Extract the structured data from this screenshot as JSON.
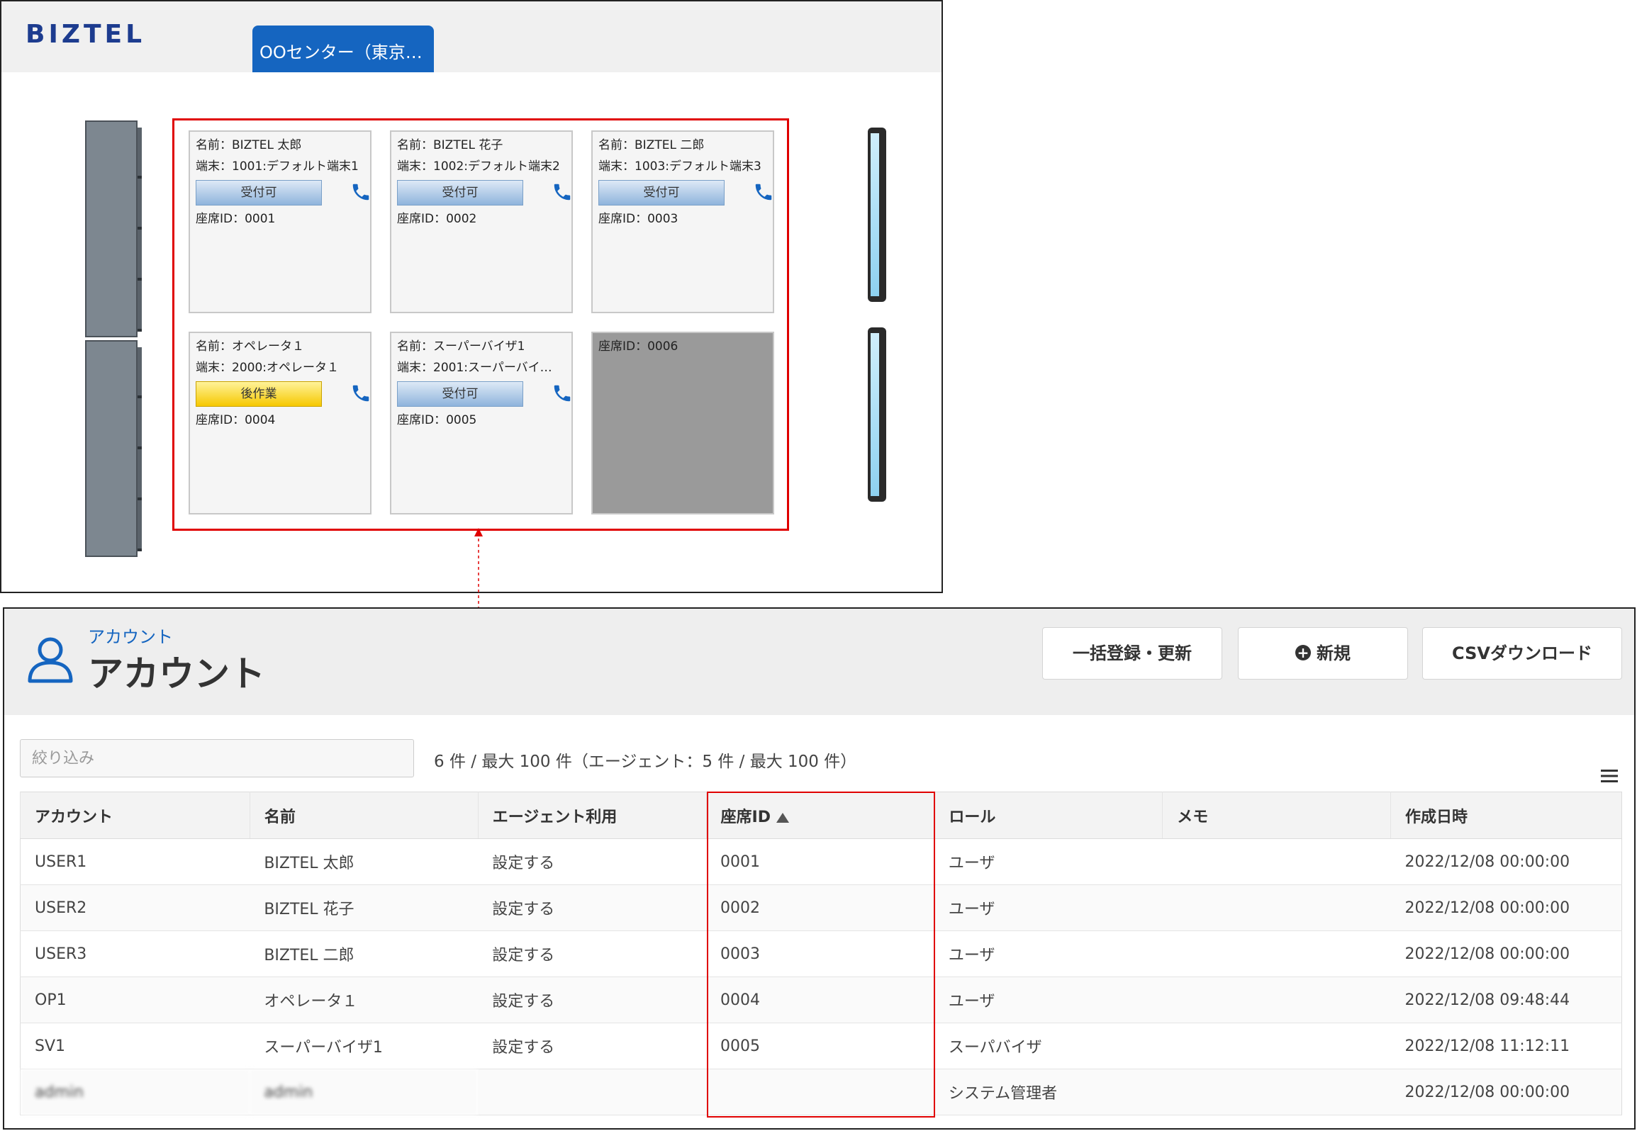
{
  "seat_map": {
    "logo": "BIZTEL",
    "center_tab": "OOセンター（東京…",
    "seats": [
      {
        "name": "名前：BIZTEL 太郎",
        "terminal": "端末：1001:デフォルト端末1",
        "status": "受付可",
        "seat_id": "座席ID：0001"
      },
      {
        "name": "名前：BIZTEL 花子",
        "terminal": "端末：1002:デフォルト端末2",
        "status": "受付可",
        "seat_id": "座席ID：0002"
      },
      {
        "name": "名前：BIZTEL 二郎",
        "terminal": "端末：1003:デフォルト端末3",
        "status": "受付可",
        "seat_id": "座席ID：0003"
      },
      {
        "name": "名前：オペレータ１",
        "terminal": "端末：2000:オペレータ１",
        "status": "後作業",
        "seat_id": "座席ID：0004"
      },
      {
        "name": "名前：スーパーバイザ1",
        "terminal": "端末：2001:スーパーバイ…",
        "status": "受付可",
        "seat_id": "座席ID：0005"
      },
      {
        "seat_id": "座席ID：0006"
      }
    ]
  },
  "accounts": {
    "breadcrumb": "アカウント",
    "title": "アカウント",
    "buttons": {
      "bulk": "一括登録・更新",
      "new": "新規",
      "csv": "CSVダウンロード"
    },
    "filter_placeholder": "絞り込み",
    "count_text": "6 件 / 最大 100 件（エージェント：5 件 / 最大 100 件）",
    "columns": [
      "アカウント",
      "名前",
      "エージェント利用",
      "座席ID",
      "ロール",
      "メモ",
      "作成日時"
    ],
    "rows": [
      [
        "USER1",
        "BIZTEL 太郎",
        "設定する",
        "0001",
        "ユーザ",
        "",
        "2022/12/08 00:00:00"
      ],
      [
        "USER2",
        "BIZTEL 花子",
        "設定する",
        "0002",
        "ユーザ",
        "",
        "2022/12/08 00:00:00"
      ],
      [
        "USER3",
        "BIZTEL 二郎",
        "設定する",
        "0003",
        "ユーザ",
        "",
        "2022/12/08 00:00:00"
      ],
      [
        "OP1",
        "オペレータ１",
        "設定する",
        "0004",
        "ユーザ",
        "",
        "2022/12/08 09:48:44"
      ],
      [
        "SV1",
        "スーパーバイザ1",
        "設定する",
        "0005",
        "スーパバイザ",
        "",
        "2022/12/08 11:12:11"
      ],
      [
        "admin",
        "admin",
        "",
        "",
        "システム管理者",
        "",
        "2022/12/08 00:00:00"
      ]
    ]
  },
  "colors": {
    "accent": "#1565c0",
    "highlight": "#e00000",
    "acw": "#f6c800"
  }
}
